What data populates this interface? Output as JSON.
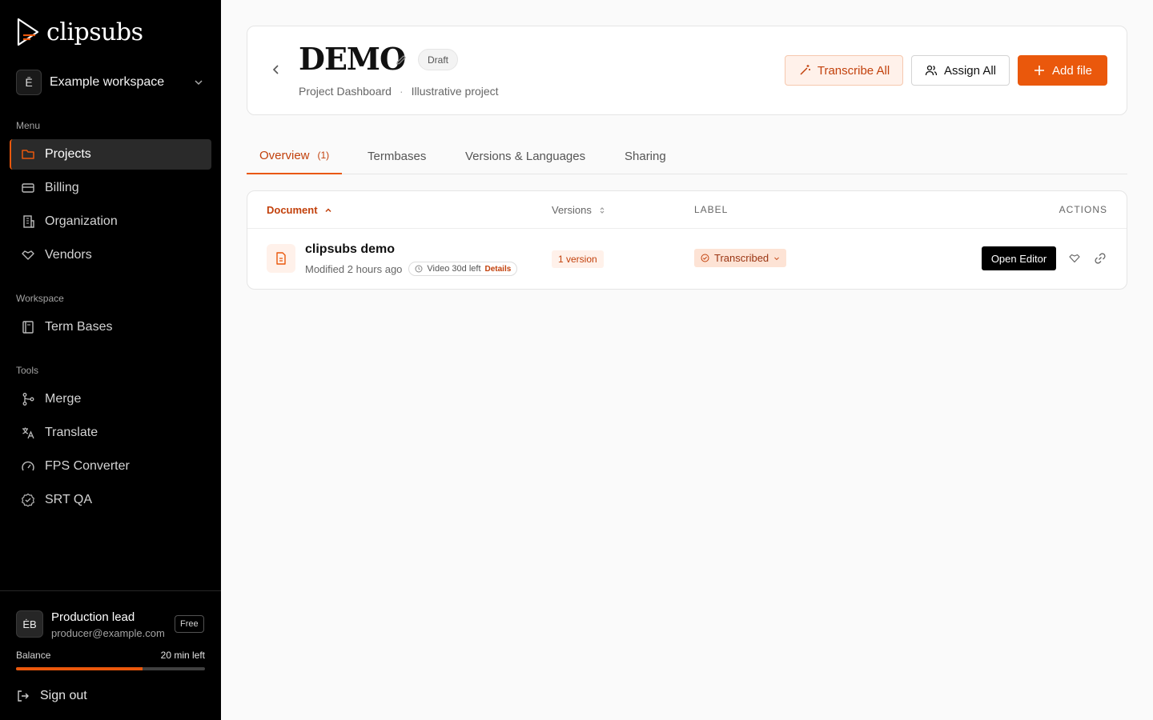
{
  "sidebar": {
    "logo_text": "clipsubs",
    "workspace": {
      "avatar": "Ē",
      "name": "Example workspace"
    },
    "sections": {
      "menu": "Menu",
      "workspace": "Workspace",
      "tools": "Tools"
    },
    "menu_items": [
      {
        "label": "Projects",
        "icon": "folder-icon",
        "active": true
      },
      {
        "label": "Billing",
        "icon": "credit-card-icon"
      },
      {
        "label": "Organization",
        "icon": "building-icon"
      },
      {
        "label": "Vendors",
        "icon": "handshake-icon"
      }
    ],
    "workspace_items": [
      {
        "label": "Term Bases",
        "icon": "book-icon"
      }
    ],
    "tool_items": [
      {
        "label": "Merge",
        "icon": "git-merge-icon"
      },
      {
        "label": "Translate",
        "icon": "translate-icon"
      },
      {
        "label": "FPS Converter",
        "icon": "gauge-icon"
      },
      {
        "label": "SRT QA",
        "icon": "check-badge-icon"
      }
    ],
    "user": {
      "avatar": "ĖB",
      "name": "Production lead",
      "email": "producer@example.com",
      "plan": "Free",
      "balance_label": "Balance",
      "balance_value": "20 min left",
      "balance_fraction": 0.67
    },
    "sign_out": "Sign out"
  },
  "header": {
    "title": "DEMO",
    "status": "Draft",
    "breadcrumb": [
      "Project Dashboard",
      "·",
      "Illustrative project"
    ],
    "buttons": {
      "transcribe_all": "Transcribe All",
      "assign_all": "Assign All",
      "add_file": "Add file"
    }
  },
  "tabs": [
    {
      "label": "Overview",
      "count": "(1)",
      "active": true
    },
    {
      "label": "Termbases"
    },
    {
      "label": "Versions & Languages"
    },
    {
      "label": "Sharing"
    }
  ],
  "table": {
    "columns": {
      "document": "Document",
      "versions": "Versions",
      "label": "LABEL",
      "actions": "ACTIONS"
    },
    "rows": [
      {
        "name": "clipsubs demo",
        "modified": "Modified 2 hours ago",
        "video_badge": "Video 30d left",
        "details": "Details",
        "versions": "1 version",
        "label": "Transcribed",
        "open_editor": "Open Editor"
      }
    ]
  },
  "colors": {
    "accent": "#ea580c",
    "accent_dark": "#c2410c",
    "sidebar_bg": "#000000"
  }
}
